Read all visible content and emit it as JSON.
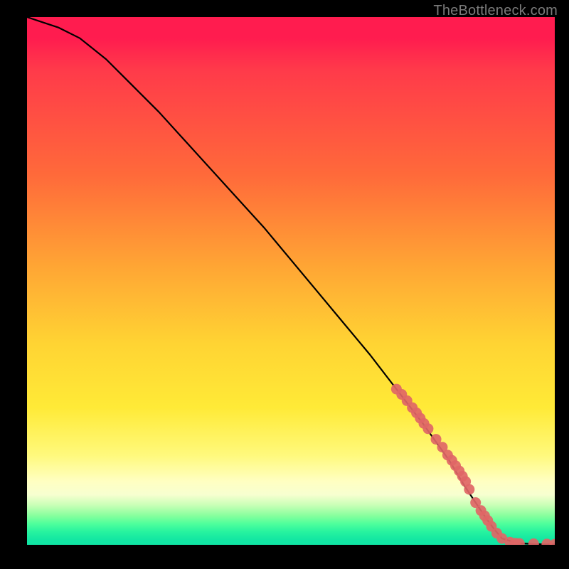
{
  "attribution": "TheBottleneck.com",
  "colors": {
    "background": "#000000",
    "gradient_top": "#ff1c4f",
    "gradient_mid1": "#ff6a3a",
    "gradient_mid2": "#ffd433",
    "gradient_mid3": "#fff97c",
    "gradient_band": "#27f39f",
    "curve_stroke": "#000000",
    "marker_fill": "#e06666",
    "attribution_color": "#7a7a7a"
  },
  "chart_data": {
    "type": "line",
    "title": "",
    "xlabel": "",
    "ylabel": "",
    "xlim": [
      0,
      100
    ],
    "ylim": [
      0,
      100
    ],
    "legend": false,
    "grid": false,
    "series": [
      {
        "name": "curve",
        "style": "line",
        "x": [
          0,
          3,
          6,
          10,
          15,
          20,
          25,
          30,
          35,
          40,
          45,
          50,
          55,
          60,
          65,
          70,
          75,
          80,
          83,
          85,
          87,
          88.5,
          90,
          93,
          96,
          98,
          100
        ],
        "values": [
          100,
          99,
          98,
          96,
          92,
          87,
          82,
          76.5,
          71,
          65.5,
          60,
          54,
          48,
          42,
          36,
          29.5,
          23,
          16,
          11,
          8,
          5,
          3,
          1.2,
          0.3,
          0.15,
          0.1,
          0.1
        ]
      },
      {
        "name": "markers",
        "style": "scatter",
        "x": [
          70,
          71,
          72,
          73,
          73.8,
          74.5,
          75.2,
          76,
          77.5,
          78.7,
          79.7,
          80.5,
          81.2,
          81.9,
          82.5,
          83.1,
          83.8,
          85,
          86,
          86.7,
          87.3,
          88,
          89,
          90,
          91.5,
          92.5,
          93.3,
          96,
          98.5,
          100
        ],
        "values": [
          29.5,
          28.5,
          27.3,
          26,
          25,
          24,
          23,
          22,
          20,
          18.5,
          17,
          16,
          15,
          14,
          13,
          12,
          10.5,
          8,
          6.5,
          5.5,
          4.6,
          3.5,
          2.2,
          1.2,
          0.5,
          0.3,
          0.25,
          0.2,
          0.15,
          0.1
        ]
      }
    ]
  }
}
